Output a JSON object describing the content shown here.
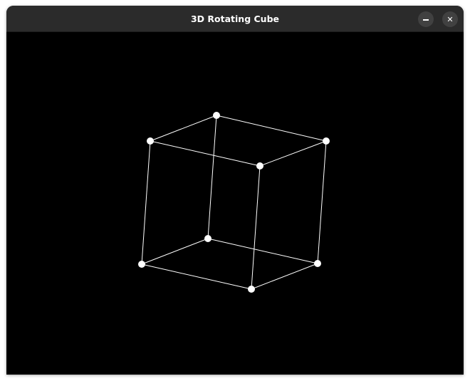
{
  "window": {
    "title": "3D Rotating Cube"
  },
  "controls": {
    "minimize_icon": "minimize-icon",
    "close_icon": "close-icon",
    "close_glyph": "✕"
  },
  "scene": {
    "background": "#000000",
    "edge_color": "#ffffff",
    "vertex_color": "#ffffff",
    "vertices": [
      {
        "id": "v0"
      },
      {
        "id": "v1"
      },
      {
        "id": "v2"
      },
      {
        "id": "v3"
      },
      {
        "id": "v4"
      },
      {
        "id": "v5"
      },
      {
        "id": "v6"
      },
      {
        "id": "v7"
      }
    ],
    "edges": [
      [
        "v0",
        "v1"
      ],
      [
        "v1",
        "v2"
      ],
      [
        "v2",
        "v3"
      ],
      [
        "v3",
        "v0"
      ],
      [
        "v4",
        "v5"
      ],
      [
        "v5",
        "v6"
      ],
      [
        "v6",
        "v7"
      ],
      [
        "v7",
        "v4"
      ],
      [
        "v0",
        "v4"
      ],
      [
        "v1",
        "v5"
      ],
      [
        "v2",
        "v6"
      ],
      [
        "v3",
        "v7"
      ]
    ]
  }
}
